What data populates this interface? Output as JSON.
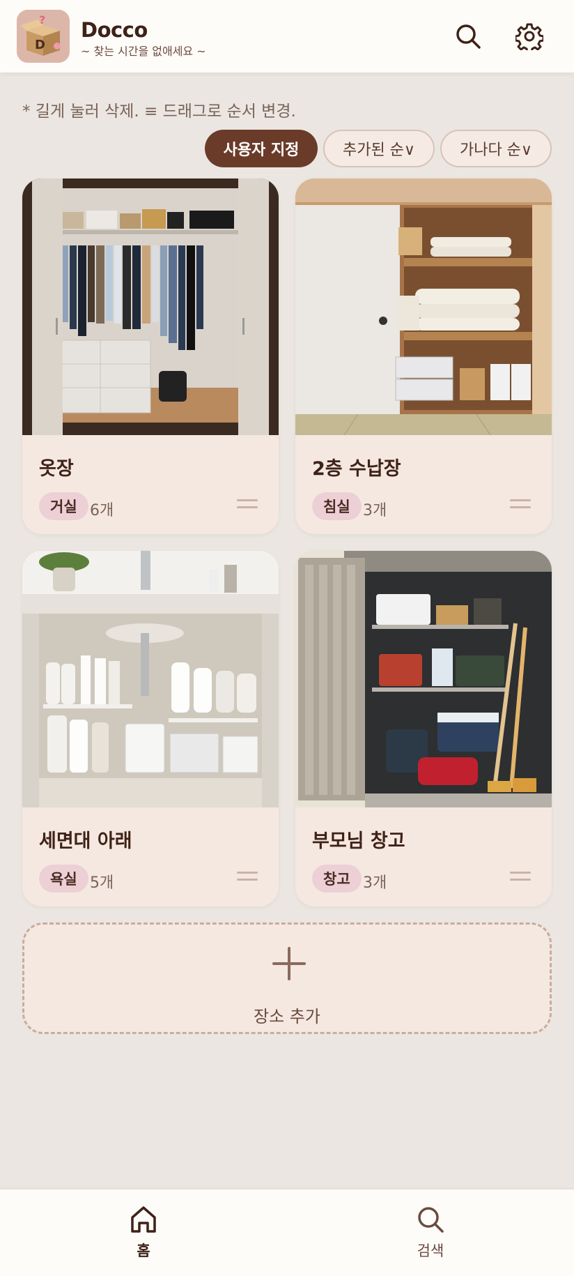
{
  "app": {
    "title": "Docco",
    "subtitle": "~ 찾는 시간을 없애세요 ~",
    "logo_letter": "D",
    "logo_mark": "?"
  },
  "header": {
    "search_icon": "search-icon",
    "settings_icon": "gear-icon"
  },
  "hint": "* 길게 눌러 삭제. ≡ 드래그로 순서 변경.",
  "sort": {
    "options": [
      {
        "label": "사용자 지정",
        "active": true
      },
      {
        "label": "추가된 순∨",
        "active": false
      },
      {
        "label": "가나다 순∨",
        "active": false
      }
    ]
  },
  "places": [
    {
      "name": "옷장",
      "tag": "거실",
      "count": "6개",
      "image": "closet-photo"
    },
    {
      "name": "2층 수납장",
      "tag": "침실",
      "count": "3개",
      "image": "storage-cabinet-photo"
    },
    {
      "name": "세면대 아래",
      "tag": "욕실",
      "count": "5개",
      "image": "under-sink-photo"
    },
    {
      "name": "부모님 창고",
      "tag": "창고",
      "count": "3개",
      "image": "storage-shed-photo"
    }
  ],
  "add_place": {
    "label": "장소 추가"
  },
  "bottom_nav": {
    "items": [
      {
        "label": "홈",
        "icon": "home-icon",
        "active": true
      },
      {
        "label": "검색",
        "icon": "search-icon",
        "active": false
      }
    ]
  },
  "colors": {
    "background": "#ebe6e1",
    "card": "#f5e8e1",
    "accent": "#6b3b2a",
    "tag": "#ecd0d6",
    "text": "#3e2217"
  }
}
